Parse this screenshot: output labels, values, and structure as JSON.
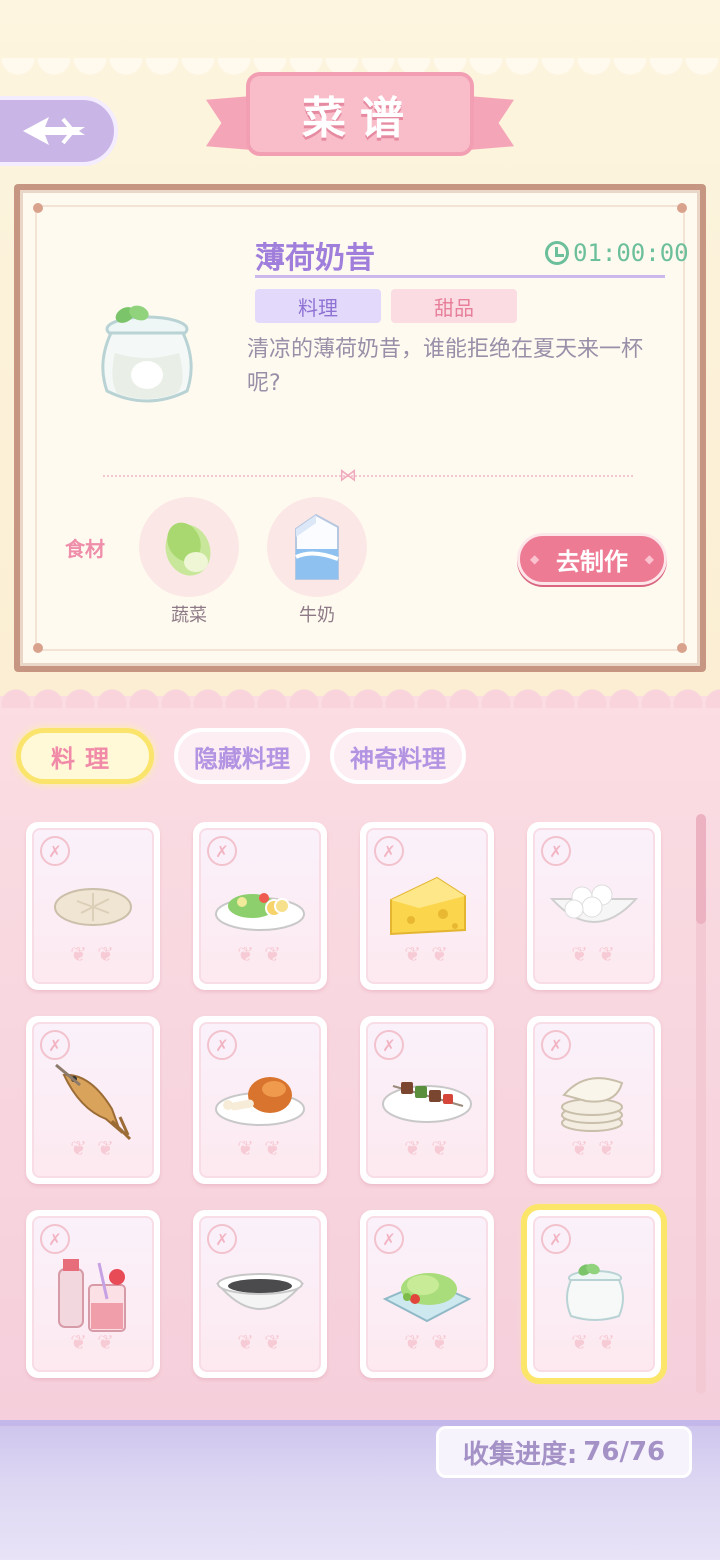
{
  "header": {
    "title": "菜谱"
  },
  "recipe": {
    "name": "薄荷奶昔",
    "time": "01:00:00",
    "tags": [
      "料理",
      "甜品"
    ],
    "description": "清凉的薄荷奶昔，谁能拒绝在夏天来一杯呢?",
    "ingredients_label": "食材",
    "ingredients": [
      {
        "name": "蔬菜",
        "icon": "cabbage-icon"
      },
      {
        "name": "牛奶",
        "icon": "milk-carton-icon"
      }
    ],
    "make_button": "去制作"
  },
  "tabs": [
    {
      "label": "料理",
      "active": true
    },
    {
      "label": "隐藏料理",
      "active": false
    },
    {
      "label": "神奇料理",
      "active": false
    }
  ],
  "grid_items": [
    {
      "icon": "flatbread-icon"
    },
    {
      "icon": "salad-plate-icon"
    },
    {
      "icon": "cheese-icon"
    },
    {
      "icon": "rice-balls-bowl-icon"
    },
    {
      "icon": "grilled-fish-icon"
    },
    {
      "icon": "roast-chicken-leg-icon"
    },
    {
      "icon": "kebab-plate-icon"
    },
    {
      "icon": "stacked-pancakes-icon"
    },
    {
      "icon": "strawberry-drinks-icon"
    },
    {
      "icon": "black-soup-bowl-icon"
    },
    {
      "icon": "lettuce-salad-icon"
    },
    {
      "icon": "mint-milkshake-icon",
      "selected": true
    }
  ],
  "footer": {
    "progress_label": "收集进度:",
    "progress_value": "76/76"
  },
  "colors": {
    "accent_pink": "#ee7b94",
    "accent_purple": "#a07fdc",
    "timer_green": "#6bbf9b",
    "selected_yellow": "#fae46b"
  }
}
